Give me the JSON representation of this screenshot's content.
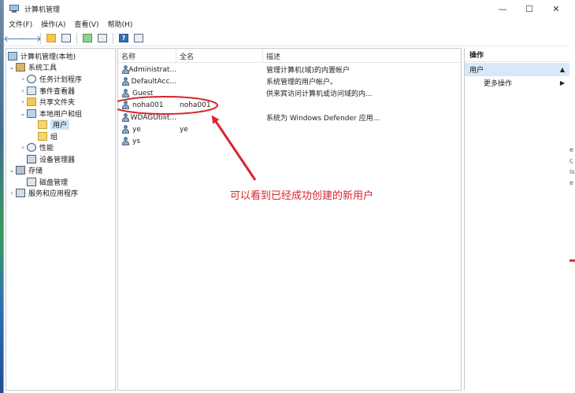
{
  "window": {
    "title": "计算机管理",
    "controls": {
      "minimize": "—",
      "maximize": "☐",
      "close": "✕"
    }
  },
  "menu": [
    "文件(F)",
    "操作(A)",
    "查看(V)",
    "帮助(H)"
  ],
  "toolbar": {
    "back": "🡐",
    "forward": "🡒",
    "icons": [
      "up-folder-icon",
      "show-hide-tree-icon",
      "refresh-icon",
      "export-icon",
      "help-icon",
      "properties-icon"
    ]
  },
  "tree": {
    "items": [
      {
        "label": "计算机管理(本地)",
        "arrow": "",
        "icon": "computer-icon"
      },
      {
        "label": "系统工具",
        "arrow": "⌄",
        "icon": "tools-icon"
      },
      {
        "label": "任务计划程序",
        "arrow": "›",
        "icon": "task-scheduler-icon"
      },
      {
        "label": "事件查看器",
        "arrow": "›",
        "icon": "event-viewer-icon"
      },
      {
        "label": "共享文件夹",
        "arrow": "›",
        "icon": "shared-folders-icon"
      },
      {
        "label": "本地用户和组",
        "arrow": "⌄",
        "icon": "local-users-icon"
      },
      {
        "label": "用户",
        "arrow": "",
        "icon": "folder-icon"
      },
      {
        "label": "组",
        "arrow": "",
        "icon": "folder-icon"
      },
      {
        "label": "性能",
        "arrow": "›",
        "icon": "performance-icon"
      },
      {
        "label": "设备管理器",
        "arrow": "",
        "icon": "device-manager-icon"
      },
      {
        "label": "存储",
        "arrow": "⌄",
        "icon": "storage-icon"
      },
      {
        "label": "磁盘管理",
        "arrow": "",
        "icon": "disk-management-icon"
      },
      {
        "label": "服务和应用程序",
        "arrow": "›",
        "icon": "services-icon"
      }
    ]
  },
  "list": {
    "columns": [
      "名称",
      "全名",
      "描述"
    ],
    "rows": [
      {
        "name": "Administrat...",
        "fullname": "",
        "description": "管理计算机(域)的内置帐户"
      },
      {
        "name": "DefaultAcc...",
        "fullname": "",
        "description": "系统管理的用户帐户。"
      },
      {
        "name": "Guest",
        "fullname": "",
        "description": "供来宾访问计算机或访问域的内..."
      },
      {
        "name": "noha001",
        "fullname": "noha001",
        "description": ""
      },
      {
        "name": "WDAGUtilit...",
        "fullname": "",
        "description": "系统为 Windows Defender 应用..."
      },
      {
        "name": "ye",
        "fullname": "ye",
        "description": ""
      },
      {
        "name": "ys",
        "fullname": "",
        "description": ""
      }
    ]
  },
  "annotation": {
    "text": "可以看到已经成功创建的新用户",
    "color": "#d8262c"
  },
  "actions": {
    "header": "操作",
    "section": "用户",
    "section_caret": "▲",
    "item": "更多操作",
    "item_caret": "▶"
  },
  "desktop_right_bits": [
    "e",
    "ς",
    "is",
    "e"
  ]
}
